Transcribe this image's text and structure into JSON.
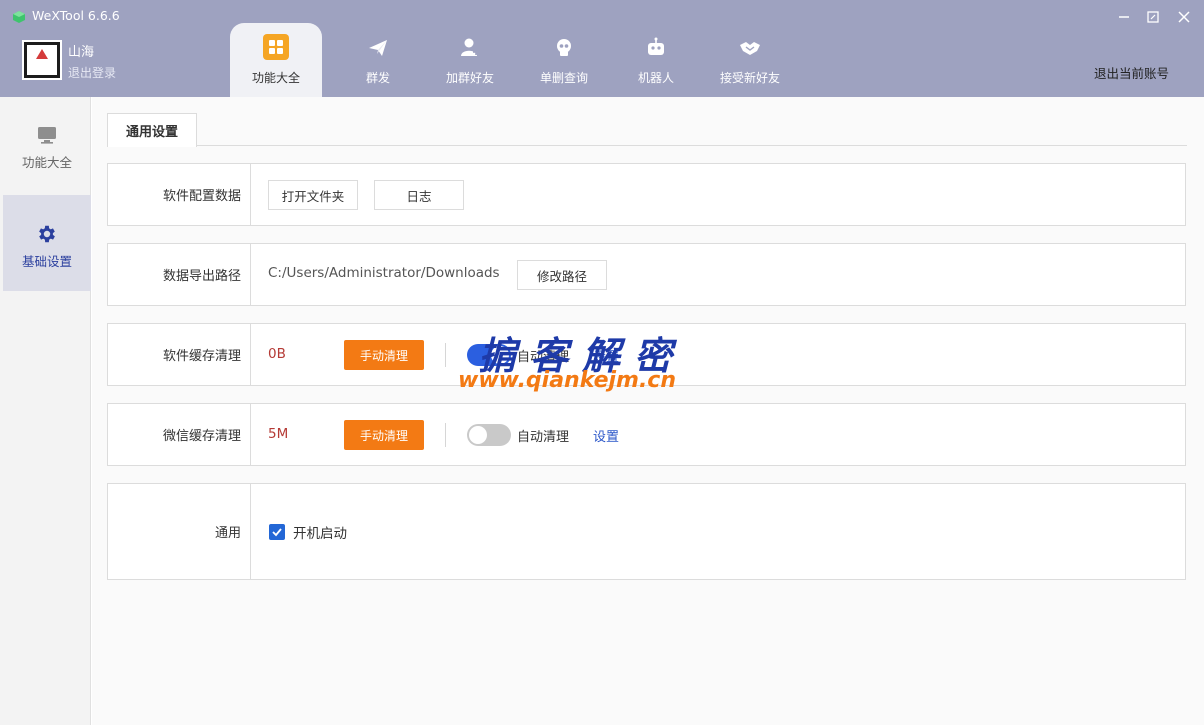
{
  "window": {
    "title": "WeXTool 6.6.6",
    "controls": {
      "minimize_icon": "minimize-icon",
      "maximize_icon": "maximize-icon",
      "close_icon": "close-icon"
    }
  },
  "user": {
    "name": "山海",
    "logout_label": "退出登录"
  },
  "top_tabs": [
    {
      "label": "功能大全",
      "icon": "grid-icon",
      "active": true
    },
    {
      "label": "群发",
      "icon": "send-icon",
      "active": false
    },
    {
      "label": "加群好友",
      "icon": "add-contact-icon",
      "active": false
    },
    {
      "label": "单删查询",
      "icon": "skull-icon",
      "active": false
    },
    {
      "label": "机器人",
      "icon": "robot-icon",
      "active": false
    },
    {
      "label": "接受新好友",
      "icon": "handshake-icon",
      "active": false
    }
  ],
  "header_right": {
    "logout_account": "退出当前账号"
  },
  "sidebar": {
    "items": [
      {
        "label": "功能大全",
        "icon": "monitor-icon",
        "active": false
      },
      {
        "label": "基础设置",
        "icon": "gear-icon",
        "active": true
      }
    ]
  },
  "main": {
    "tab": "通用设置",
    "rows": {
      "config": {
        "label": "软件配置数据",
        "open_folder": "打开文件夹",
        "log": "日志"
      },
      "export_path": {
        "label": "数据导出路径",
        "path": "C:/Users/Administrator/Downloads",
        "change": "修改路径"
      },
      "software_cache": {
        "label": "软件缓存清理",
        "size": "0B",
        "manual": "手动清理",
        "auto_enabled": true,
        "auto_label": "自动清理",
        "settings": "设置"
      },
      "wechat_cache": {
        "label": "微信缓存清理",
        "size": "5M",
        "manual": "手动清理",
        "auto_enabled": false,
        "auto_label": "自动清理",
        "settings": "设置"
      },
      "general": {
        "label": "通用",
        "startup_checked": true,
        "startup_label": "开机启动"
      }
    }
  },
  "watermark": {
    "title": "掮客解密",
    "url": "www.qiankejm.cn"
  },
  "colors": {
    "header_bg": "#9ea2c0",
    "accent_blue": "#2b5fe0",
    "accent_orange": "#f37a14",
    "size_red": "#b53b36"
  }
}
